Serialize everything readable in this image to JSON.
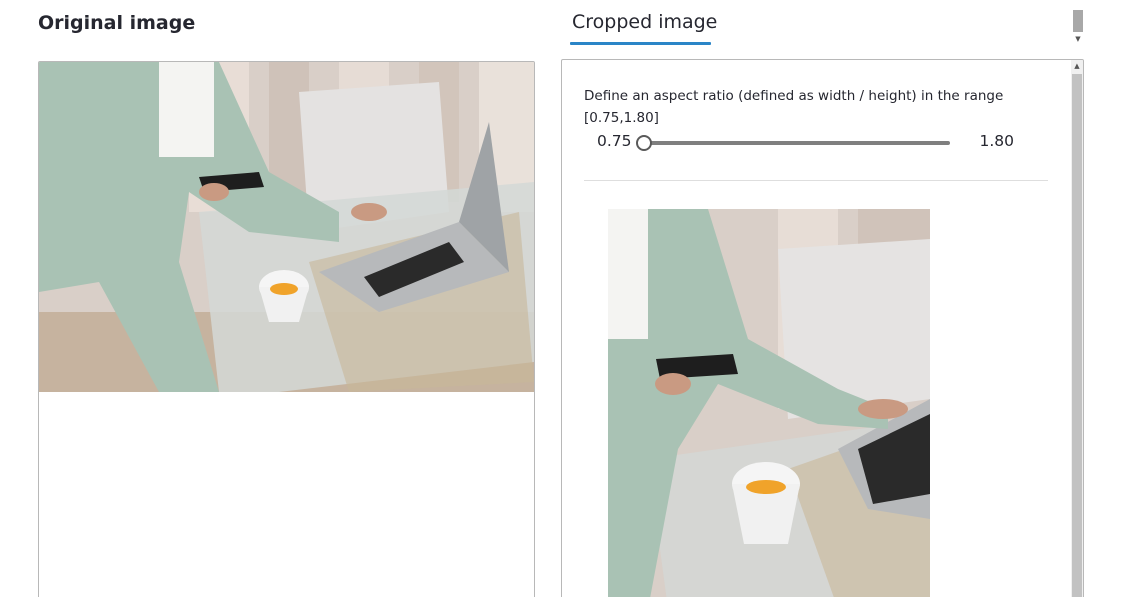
{
  "original": {
    "title": "Original image"
  },
  "tab": {
    "label": "Cropped image"
  },
  "cropper": {
    "description": "Define an aspect ratio (defined as width / height) in the range [0.75,1.80]",
    "slider": {
      "min_label": "0.75",
      "max_label": "1.80",
      "value": 0.75,
      "min": 0.75,
      "max": 1.8
    }
  },
  "icons": {
    "scroll_up": "scroll-up-arrow-icon",
    "scroll_down": "scroll-down-arrow-icon"
  }
}
